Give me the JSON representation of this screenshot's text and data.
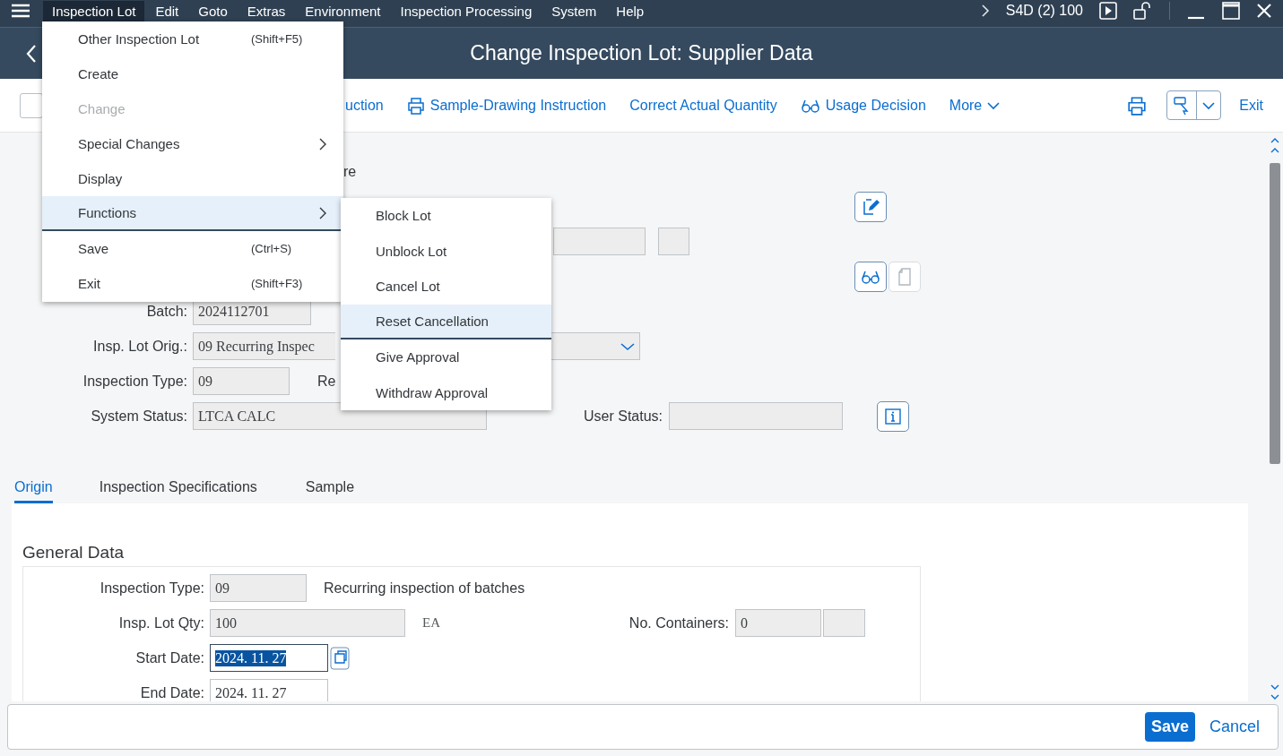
{
  "menu_bar": {
    "items": [
      {
        "label": "Inspection Lot",
        "selected": true
      },
      {
        "label": "Edit",
        "selected": false
      },
      {
        "label": "Goto",
        "selected": false
      },
      {
        "label": "Extras",
        "selected": false
      },
      {
        "label": "Environment",
        "selected": false
      },
      {
        "label": "Inspection Processing",
        "selected": false
      },
      {
        "label": "System",
        "selected": false
      },
      {
        "label": "Help",
        "selected": false
      }
    ],
    "system": "S4D (2) 100"
  },
  "title": "Change Inspection Lot: Supplier Data",
  "toolbar": {
    "items": [
      {
        "label": "uction",
        "kind": "text"
      },
      {
        "label": "Sample-Drawing Instruction",
        "kind": "print"
      },
      {
        "label": "Correct Actual Quantity",
        "kind": "text"
      },
      {
        "label": "Usage Decision",
        "kind": "glasses"
      },
      {
        "label": "More",
        "kind": "more"
      }
    ],
    "exit": "Exit"
  },
  "dropdown_menu": {
    "items": [
      {
        "label": "Other Inspection Lot",
        "shortcut": "(Shift+F5)",
        "disabled": false,
        "submenu": false,
        "selected": false
      },
      {
        "label": "Create",
        "disabled": false,
        "submenu": false,
        "selected": false
      },
      {
        "label": "Change",
        "disabled": true,
        "submenu": false,
        "selected": false
      },
      {
        "label": "Special Changes",
        "disabled": false,
        "submenu": true,
        "selected": false
      },
      {
        "label": "Display",
        "disabled": false,
        "submenu": false,
        "selected": false
      },
      {
        "label": "Functions",
        "disabled": false,
        "submenu": true,
        "selected": true
      },
      {
        "label": "Save",
        "shortcut": "(Ctrl+S)",
        "disabled": false,
        "submenu": false,
        "selected": false
      },
      {
        "label": "Exit",
        "shortcut": "(Shift+F3)",
        "disabled": false,
        "submenu": false,
        "selected": false
      }
    ]
  },
  "submenu": {
    "items": [
      {
        "label": "Block Lot",
        "selected": false
      },
      {
        "label": "Unblock Lot",
        "selected": false
      },
      {
        "label": "Cancel Lot",
        "selected": false
      },
      {
        "label": "Reset Cancellation",
        "selected": true
      },
      {
        "label": "Give Approval",
        "selected": false
      },
      {
        "label": "Withdraw Approval",
        "selected": false
      }
    ]
  },
  "header": {
    "partial_text": "re",
    "batch": {
      "label": "Batch:",
      "value": "2024112701"
    },
    "origin": {
      "label": "Insp. Lot Orig.:",
      "value": "09 Recurring Inspec"
    },
    "inspection_type": {
      "label": "Inspection Type:",
      "value": "09",
      "text": "Re"
    },
    "system_status": {
      "label": "System Status:",
      "value": "LTCA  CALC"
    },
    "user_status": {
      "label": "User Status:"
    }
  },
  "tabs": [
    {
      "label": "Origin",
      "selected": true
    },
    {
      "label": "Inspection Specifications",
      "selected": false
    },
    {
      "label": "Sample",
      "selected": false
    }
  ],
  "general_data": {
    "title": "General Data",
    "inspection_type": {
      "label": "Inspection Type:",
      "value": "09",
      "text": "Recurring inspection of batches"
    },
    "lot_qty": {
      "label": "Insp. Lot Qty:",
      "value": "100",
      "unit": "EA"
    },
    "containers": {
      "label": "No. Containers:",
      "value": "0"
    },
    "start_date": {
      "label": "Start Date:",
      "value": "2024. 11. 27",
      "selected": true
    },
    "end_date": {
      "label": "End Date:",
      "value": "2024. 11. 27",
      "selected": false
    }
  },
  "footer": {
    "save": "Save",
    "cancel": "Cancel"
  }
}
